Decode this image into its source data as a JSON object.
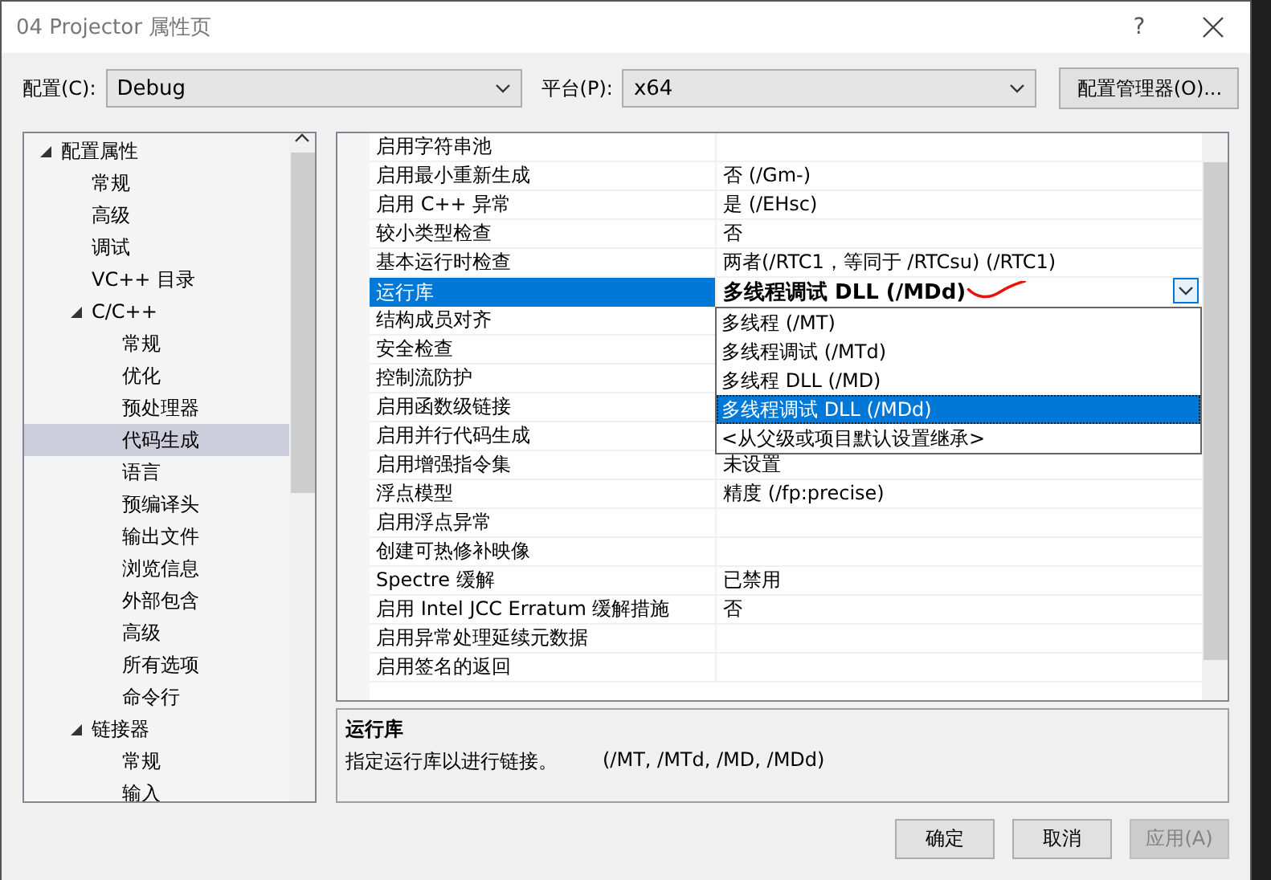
{
  "window": {
    "title": "04 Projector 属性页",
    "help": "?"
  },
  "config": {
    "label": "配置(C):",
    "value": "Debug"
  },
  "platform": {
    "label": "平台(P):",
    "value": "x64"
  },
  "manager_button": "配置管理器(O)...",
  "tree": [
    {
      "label": "配置属性",
      "expanded": true,
      "selected": false,
      "children": [
        {
          "label": "常规",
          "selected": false
        },
        {
          "label": "高级",
          "selected": false
        },
        {
          "label": "调试",
          "selected": false
        },
        {
          "label": "VC++ 目录",
          "selected": false
        },
        {
          "label": "C/C++",
          "expanded": true,
          "selected": false,
          "children": [
            {
              "label": "常规",
              "selected": false
            },
            {
              "label": "优化",
              "selected": false
            },
            {
              "label": "预处理器",
              "selected": false
            },
            {
              "label": "代码生成",
              "selected": true
            },
            {
              "label": "语言",
              "selected": false
            },
            {
              "label": "预编译头",
              "selected": false
            },
            {
              "label": "输出文件",
              "selected": false
            },
            {
              "label": "浏览信息",
              "selected": false
            },
            {
              "label": "外部包含",
              "selected": false
            },
            {
              "label": "高级",
              "selected": false
            },
            {
              "label": "所有选项",
              "selected": false
            },
            {
              "label": "命令行",
              "selected": false
            }
          ]
        },
        {
          "label": "链接器",
          "expanded": true,
          "selected": false,
          "children": [
            {
              "label": "常规",
              "selected": false
            },
            {
              "label": "输入",
              "selected": false
            }
          ]
        }
      ]
    }
  ],
  "properties": [
    {
      "name": "启用字符串池",
      "selected": false
    },
    {
      "name": "启用最小重新生成",
      "value": "否 (/Gm-)",
      "selected": false,
      "modified": false
    },
    {
      "name": "启用 C++ 异常",
      "value": "是 (/EHsc)",
      "selected": false,
      "modified": false
    },
    {
      "name": "较小类型检查",
      "value": "否",
      "selected": false,
      "modified": false
    },
    {
      "name": "基本运行时检查",
      "value": "两者(/RTC1，等同于 /RTCsu) (/RTC1)",
      "selected": false,
      "modified": false
    },
    {
      "name": "运行库",
      "value": "多线程调试 DLL (/MDd)",
      "selected": true,
      "modified": true
    },
    {
      "name": "结构成员对齐",
      "selected": false
    },
    {
      "name": "安全检查",
      "selected": false
    },
    {
      "name": "控制流防护",
      "selected": false
    },
    {
      "name": "启用函数级链接",
      "selected": false
    },
    {
      "name": "启用并行代码生成",
      "selected": false
    },
    {
      "name": "启用增强指令集",
      "value": "未设置",
      "selected": false,
      "modified": false
    },
    {
      "name": "浮点模型",
      "value": "精度 (/fp:precise)",
      "selected": false,
      "modified": false
    },
    {
      "name": "启用浮点异常",
      "selected": false
    },
    {
      "name": "创建可热修补映像",
      "selected": false
    },
    {
      "name": "Spectre 缓解",
      "value": "已禁用",
      "selected": false,
      "modified": false
    },
    {
      "name": "启用 Intel JCC Erratum 缓解措施",
      "value": "否",
      "selected": false,
      "modified": false
    },
    {
      "name": "启用异常处理延续元数据",
      "selected": false
    },
    {
      "name": "启用签名的返回",
      "selected": false
    }
  ],
  "dropdown": {
    "open": true,
    "options": [
      {
        "label": "多线程 (/MT)",
        "selected": false
      },
      {
        "label": "多线程调试 (/MTd)",
        "selected": false
      },
      {
        "label": "多线程 DLL (/MD)",
        "selected": false
      },
      {
        "label": "多线程调试 DLL (/MDd)",
        "selected": true
      },
      {
        "label": "<从父级或项目默认设置继承>",
        "selected": false
      }
    ]
  },
  "description": {
    "title": "运行库",
    "text": "指定运行库以进行链接。",
    "switches": "(/MT, /MTd, /MD, /MDd)"
  },
  "buttons": [
    {
      "label": "确定",
      "disabled": false
    },
    {
      "label": "取消",
      "disabled": false
    },
    {
      "label": "应用(A)",
      "disabled": true
    }
  ]
}
